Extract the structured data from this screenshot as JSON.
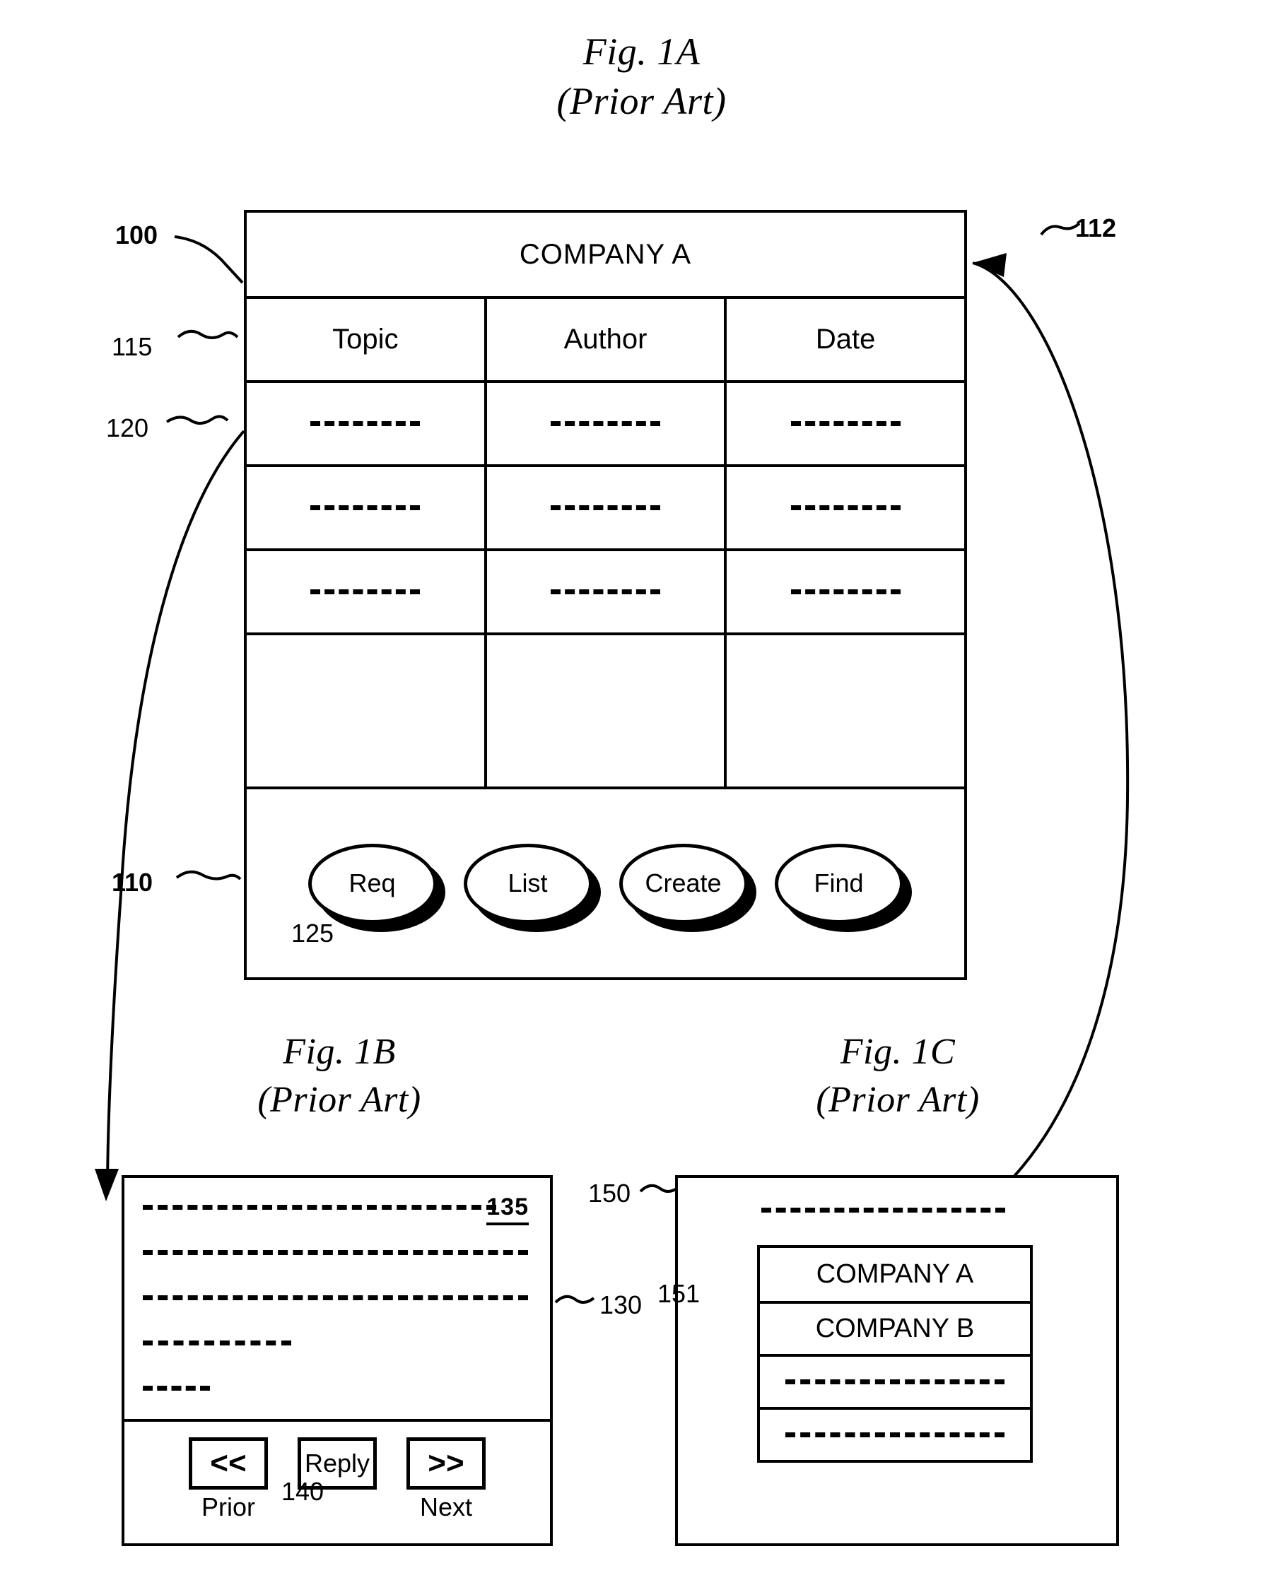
{
  "figures": {
    "fig1a": {
      "title": "Fig. 1A",
      "subtitle": "(Prior Art)"
    },
    "fig1b": {
      "title": "Fig. 1B",
      "subtitle": "(Prior Art)"
    },
    "fig1c": {
      "title": "Fig. 1C",
      "subtitle": "(Prior Art)"
    }
  },
  "fig1a_window": {
    "title_bar_text": "COMPANY A",
    "column_headers": [
      "Topic",
      "Author",
      "Date"
    ],
    "data_rows": [
      [
        "--------------",
        "--------------",
        "--------------"
      ],
      [
        "--------------",
        "--------------",
        "--------------"
      ],
      [
        "--------------",
        "--------------",
        "--------------"
      ]
    ],
    "blank_row": true,
    "buttons": [
      "Req",
      "List",
      "Create",
      "Find"
    ]
  },
  "fig1b_window": {
    "message_lines": [
      "----------------------------",
      "----------------------------",
      "----------------------------",
      "---------------",
      "-------"
    ],
    "message_label": "135",
    "buttons": [
      {
        "glyph": "<<",
        "label": "Prior"
      },
      {
        "glyph": "Reply",
        "label": ""
      },
      {
        "glyph": ">>",
        "label": "Next"
      }
    ]
  },
  "fig1c_window": {
    "top_dash": "-------------------------",
    "list_items": [
      "COMPANY A",
      "COMPANY B",
      "-------------------------",
      "-------------------------"
    ]
  },
  "reference_numerals": [
    {
      "id": "100",
      "text": "100",
      "bold": true
    },
    {
      "id": "112",
      "text": "112",
      "bold": true
    },
    {
      "id": "115",
      "text": "115",
      "bold": false
    },
    {
      "id": "120",
      "text": "120",
      "bold": false
    },
    {
      "id": "110",
      "text": "110",
      "bold": true
    },
    {
      "id": "125",
      "text": "125",
      "bold": false
    },
    {
      "id": "130",
      "text": "130",
      "bold": false
    },
    {
      "id": "135",
      "text": "135",
      "bold": true
    },
    {
      "id": "140",
      "text": "140",
      "bold": false
    },
    {
      "id": "150",
      "text": "150",
      "bold": false
    },
    {
      "id": "151",
      "text": "151",
      "bold": false
    }
  ],
  "colors": {
    "ink": "#000000",
    "paper": "#ffffff"
  }
}
